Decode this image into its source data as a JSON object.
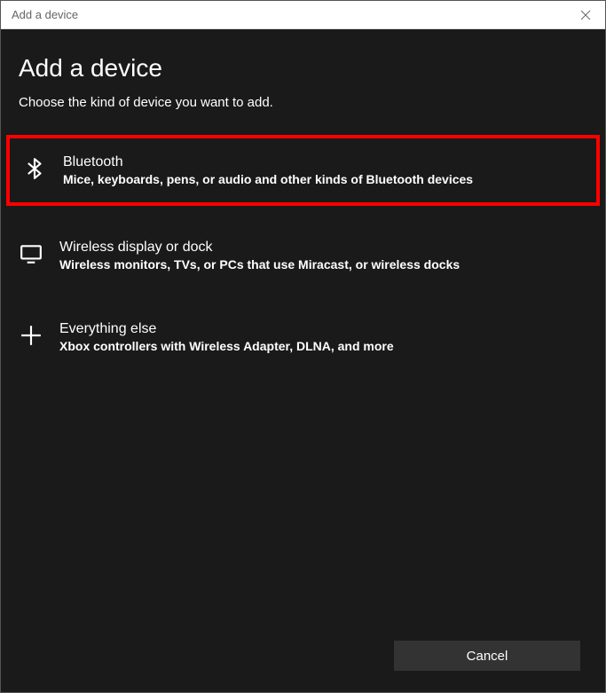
{
  "titlebar": {
    "title": "Add a device"
  },
  "heading": "Add a device",
  "subheading": "Choose the kind of device you want to add.",
  "options": [
    {
      "title": "Bluetooth",
      "desc": "Mice, keyboards, pens, or audio and other kinds of Bluetooth devices"
    },
    {
      "title": "Wireless display or dock",
      "desc": "Wireless monitors, TVs, or PCs that use Miracast, or wireless docks"
    },
    {
      "title": "Everything else",
      "desc": "Xbox controllers with Wireless Adapter, DLNA, and more"
    }
  ],
  "footer": {
    "cancel": "Cancel"
  }
}
